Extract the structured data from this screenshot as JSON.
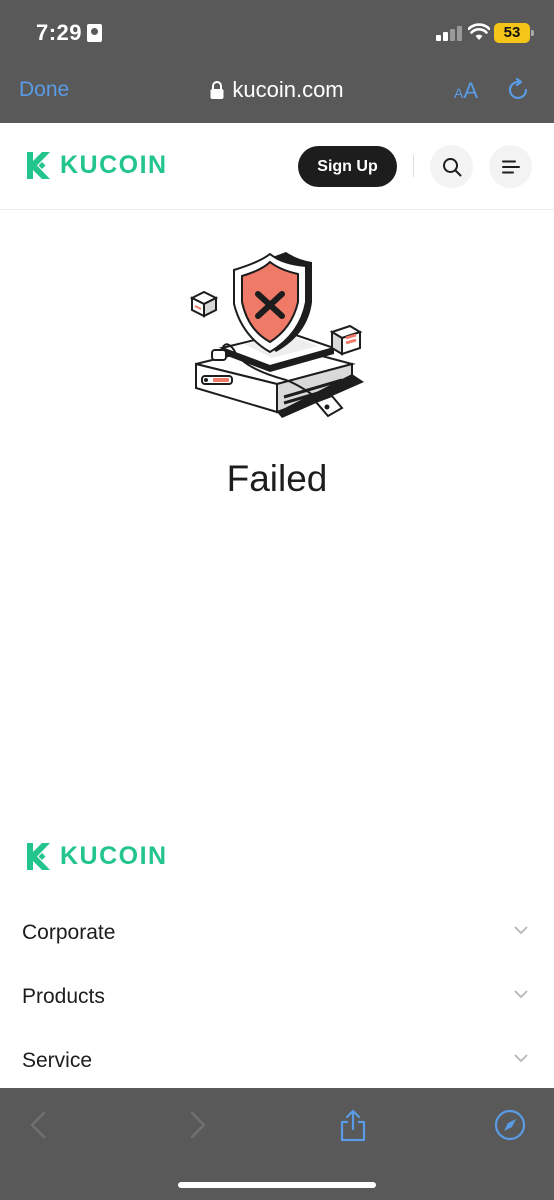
{
  "status_bar": {
    "time": "7:29",
    "battery": "53",
    "icons": [
      "id-card-icon",
      "cellular-signal-icon",
      "wifi-icon",
      "battery-icon"
    ]
  },
  "browser": {
    "done_label": "Done",
    "url": "kucoin.com",
    "text_size_small": "A",
    "text_size_big": "A",
    "accent_color": "#5a9be6",
    "chrome_color": "#595959"
  },
  "header": {
    "brand": "KUCOIN",
    "brand_color": "#23c58c",
    "signup_label": "Sign Up",
    "icons": [
      "search-icon",
      "menu-icon"
    ]
  },
  "main": {
    "status_title": "Failed",
    "illustration": "security-failed-shield-illustration"
  },
  "footer": {
    "brand": "KUCOIN",
    "sections": [
      {
        "label": "Corporate"
      },
      {
        "label": "Products"
      },
      {
        "label": "Service"
      }
    ]
  },
  "toolbar": {
    "icons": [
      "back-icon",
      "forward-icon",
      "share-icon",
      "compass-icon"
    ]
  }
}
